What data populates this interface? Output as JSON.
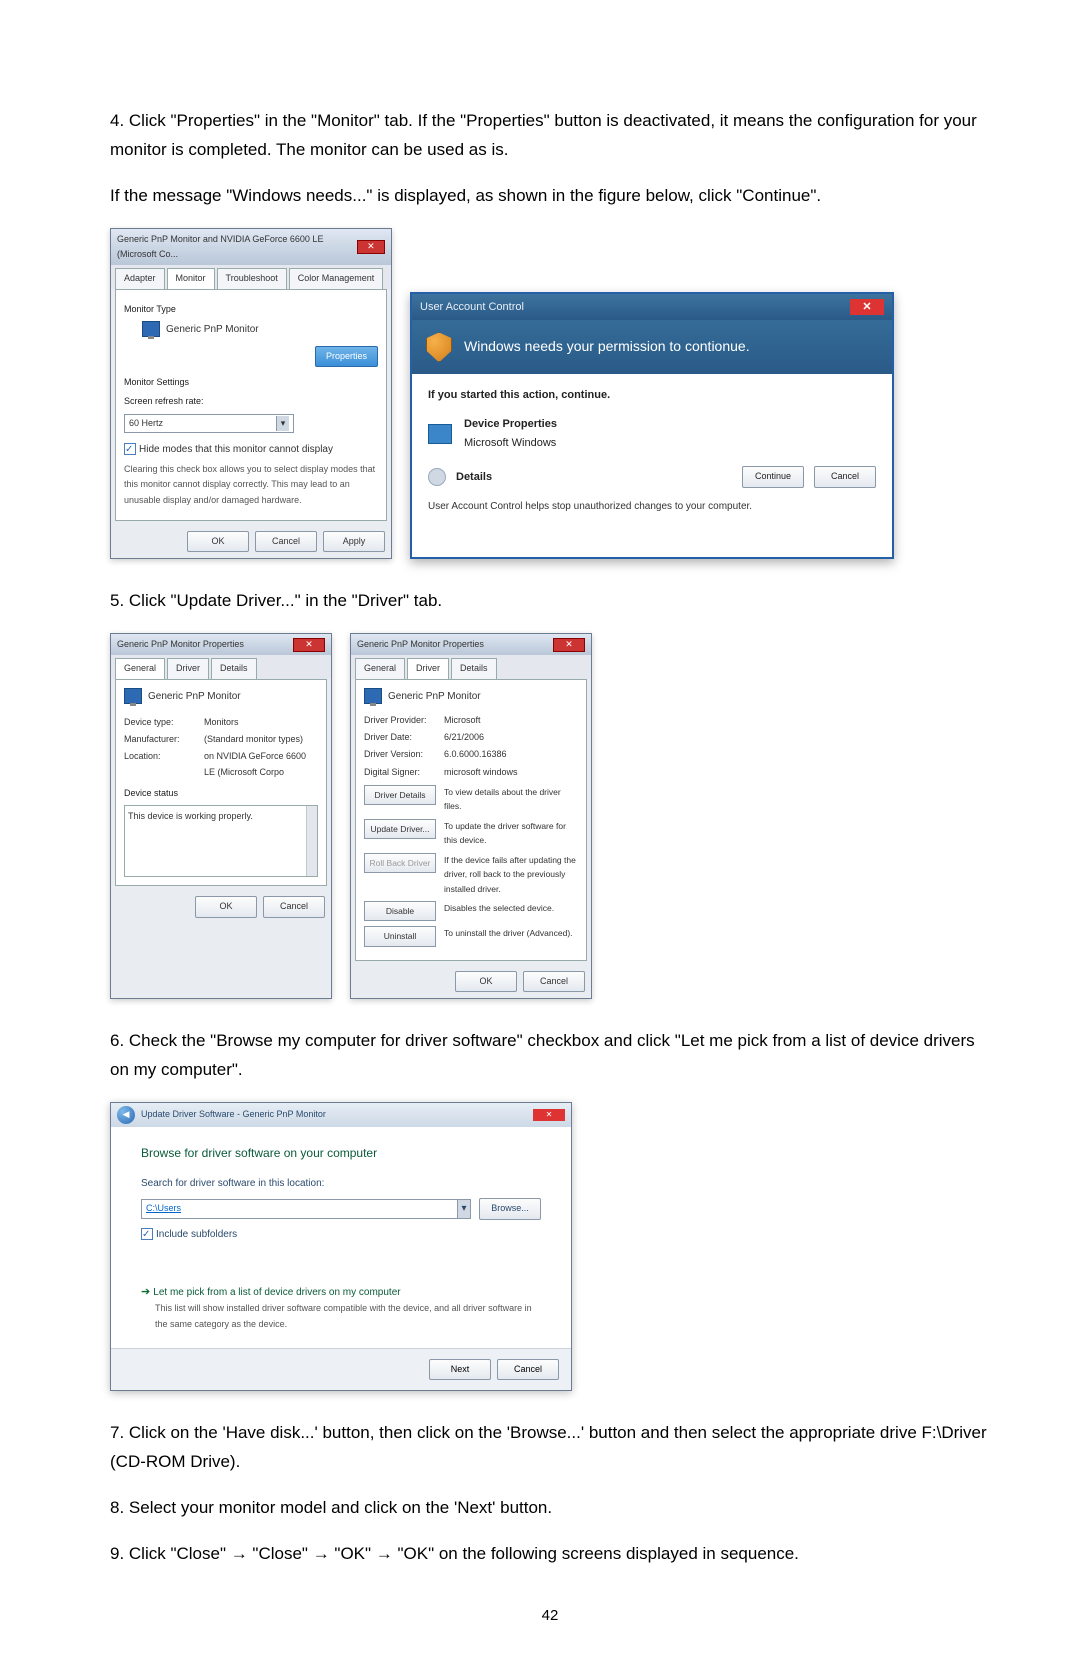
{
  "step4": {
    "text_a": "4. Click \"Properties\" in the \"Monitor\" tab. If the \"Properties\" button is deactivated, it means the configuration for your monitor is completed. The monitor can be used as is.",
    "text_b": "If the message \"Windows needs...\" is displayed, as shown in the figure below, click \"Continue\"."
  },
  "monitor_dialog": {
    "title": "Generic PnP Monitor and NVIDIA GeForce 6600 LE (Microsoft Co...",
    "tabs": [
      "Adapter",
      "Monitor",
      "Troubleshoot",
      "Color Management"
    ],
    "type_label": "Monitor Type",
    "monitor_name": "Generic PnP Monitor",
    "properties_btn": "Properties",
    "settings_label": "Monitor Settings",
    "refresh_label": "Screen refresh rate:",
    "refresh_value": "60 Hertz",
    "hide_modes": "Hide modes that this monitor cannot display",
    "hide_modes_desc": "Clearing this check box allows you to select display modes that this monitor cannot display correctly. This may lead to an unusable display and/or damaged hardware.",
    "ok": "OK",
    "cancel": "Cancel",
    "apply": "Apply"
  },
  "uac": {
    "title": "User Account Control",
    "message": "Windows needs your permission to contionue.",
    "started": "If you started this action, continue.",
    "item_title": "Device Properties",
    "item_vendor": "Microsoft Windows",
    "details": "Details",
    "continue": "Continue",
    "cancel": "Cancel",
    "footer": "User Account Control helps stop unauthorized changes to your computer."
  },
  "step5": {
    "text": "5. Click \"Update Driver...\" in the \"Driver\" tab."
  },
  "props_general": {
    "title": "Generic PnP Monitor Properties",
    "tabs": [
      "General",
      "Driver",
      "Details"
    ],
    "name": "Generic PnP Monitor",
    "rows": {
      "device_type_k": "Device type:",
      "device_type_v": "Monitors",
      "manufacturer_k": "Manufacturer:",
      "manufacturer_v": "(Standard monitor types)",
      "location_k": "Location:",
      "location_v": "on NVIDIA GeForce 6600 LE (Microsoft Corpo"
    },
    "status_label": "Device status",
    "status_text": "This device is working properly.",
    "ok": "OK",
    "cancel": "Cancel"
  },
  "props_driver": {
    "title": "Generic PnP Monitor Properties",
    "tabs": [
      "General",
      "Driver",
      "Details"
    ],
    "name": "Generic PnP Monitor",
    "rows": {
      "provider_k": "Driver Provider:",
      "provider_v": "Microsoft",
      "date_k": "Driver Date:",
      "date_v": "6/21/2006",
      "version_k": "Driver Version:",
      "version_v": "6.0.6000.16386",
      "signer_k": "Digital Signer:",
      "signer_v": "microsoft windows"
    },
    "btns": {
      "details": "Driver Details",
      "details_d": "To view details about the driver files.",
      "update": "Update Driver...",
      "update_d": "To update the driver software for this device.",
      "rollback": "Roll Back Driver",
      "rollback_d": "If the device fails after updating the driver, roll back to the previously installed driver.",
      "disable": "Disable",
      "disable_d": "Disables the selected device.",
      "uninstall": "Uninstall",
      "uninstall_d": "To uninstall the driver (Advanced)."
    },
    "ok": "OK",
    "cancel": "Cancel"
  },
  "step6": {
    "text": "6. Check the \"Browse my computer for driver software\" checkbox and click \"Let me pick from a list of device drivers on my computer\"."
  },
  "update_wizard": {
    "title": "Update Driver Software - Generic PnP Monitor",
    "heading": "Browse for driver software on your computer",
    "search_label": "Search for driver software in this location:",
    "path": "C:\\Users",
    "browse": "Browse...",
    "include_sub": "Include subfolders",
    "let_me_pick": "Let me pick from a list of device drivers on my computer",
    "let_me_pick_desc": "This list will show installed driver software compatible with the device, and all driver software in the same category as the device.",
    "next": "Next",
    "cancel": "Cancel"
  },
  "step7": {
    "text": "7. Click on the 'Have disk...' button, then click on the 'Browse...' button and then select the appropriate drive F:\\Driver (CD-ROM Drive)."
  },
  "step8": {
    "text": "8. Select your monitor model and click on the 'Next' button."
  },
  "step9": {
    "text": "9. Click \"Close\"  →  \"Close\"  →  \"OK\"  →  \"OK\" on the following screens displayed in sequence."
  },
  "page_number": "42"
}
